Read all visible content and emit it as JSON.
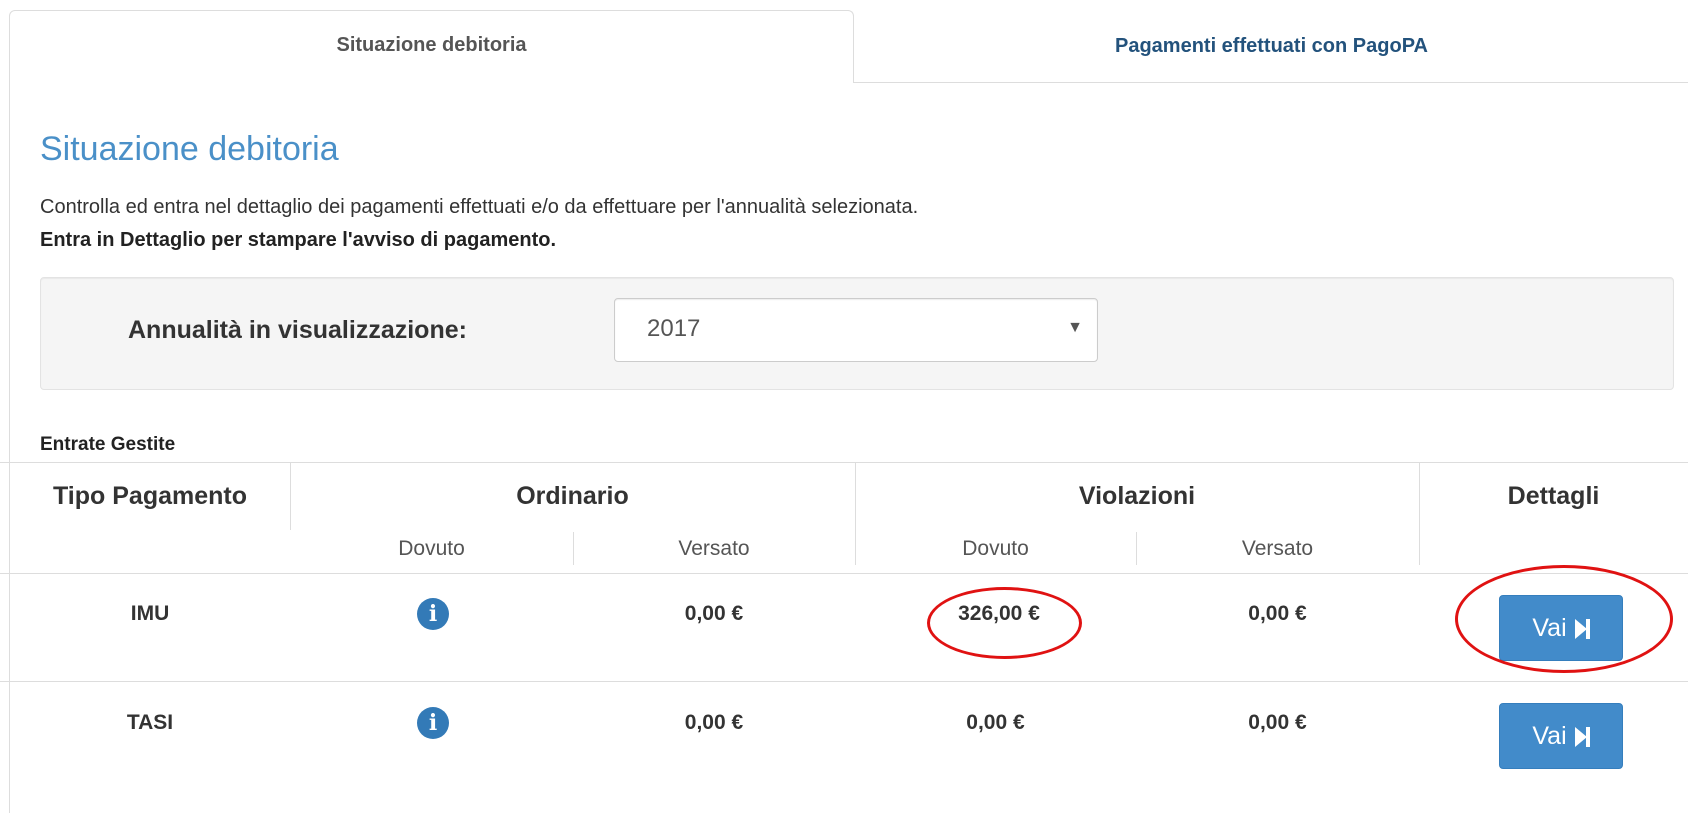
{
  "tabs": [
    {
      "label": "Situazione debitoria",
      "active": true
    },
    {
      "label": "Pagamenti effettuati con PagoPA",
      "active": false
    }
  ],
  "page": {
    "title": "Situazione debitoria",
    "description": "Controlla ed entra nel dettaglio dei pagamenti effettuati e/o da effettuare per l'annualità selezionata.",
    "description_bold": "Entra in Dettaglio per stampare l'avviso di pagamento."
  },
  "filter": {
    "label": "Annualità in visualizzazione:",
    "selected_year": "2017",
    "caret": "▼"
  },
  "section_label": "Entrate Gestite",
  "table": {
    "headers": {
      "tipo": "Tipo Pagamento",
      "ordinario": "Ordinario",
      "violazioni": "Violazioni",
      "dettagli": "Dettagli"
    },
    "subheaders": [
      "Dovuto",
      "Versato",
      "Dovuto",
      "Versato"
    ],
    "rows": [
      {
        "tipo": "IMU",
        "ord_dovuto_icon": "info-icon",
        "ord_versato": "0,00 €",
        "vio_dovuto": "326,00 €",
        "vio_versato": "0,00 €",
        "button": "Vai"
      },
      {
        "tipo": "TASI",
        "ord_dovuto_icon": "info-icon",
        "ord_versato": "0,00 €",
        "vio_dovuto": "0,00 €",
        "vio_versato": "0,00 €",
        "button": "Vai"
      }
    ]
  },
  "colors": {
    "accent_blue": "#337ab7",
    "button_blue": "#428bca",
    "title_blue": "#4a90c8",
    "highlight_red": "#e01212"
  }
}
